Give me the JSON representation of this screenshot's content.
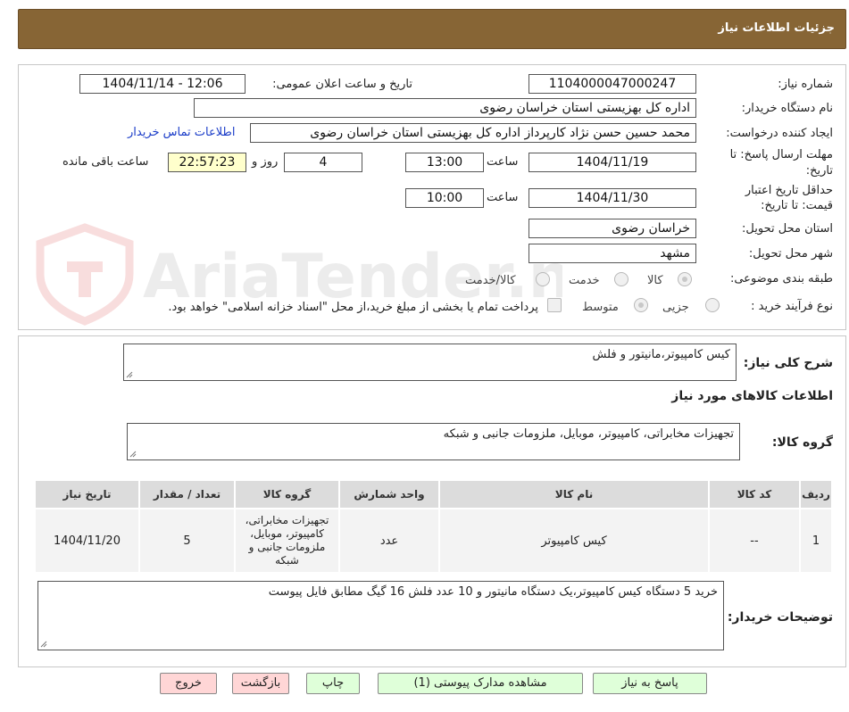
{
  "header": {
    "title": "جزئیات اطلاعات نیاز"
  },
  "fields": {
    "need_number_label": "شماره نیاز:",
    "need_number": "1104000047000247",
    "announce_label": "تاریخ و ساعت اعلان عمومی:",
    "announce_value": "1404/11/14 - 12:06",
    "buyer_org_label": "نام دستگاه خریدار:",
    "buyer_org": "اداره کل بهزیستی استان خراسان رضوی",
    "creator_label": "ایجاد کننده درخواست:",
    "creator": "محمد حسین حسن نژاد کارپرداز اداره کل بهزیستی استان خراسان رضوی",
    "contact_link": "اطلاعات تماس خریدار",
    "deadline_label_1": "مهلت ارسال پاسخ: تا",
    "deadline_label_2": "تاریخ:",
    "deadline_date": "1404/11/19",
    "hour_label": "ساعت",
    "deadline_time": "13:00",
    "days_value": "4",
    "days_label": "روز و",
    "remaining_time": "22:57:23",
    "remaining_label": "ساعت باقی مانده",
    "validity_label_1": "حداقل تاریخ اعتبار",
    "validity_label_2": "قیمت: تا تاریخ:",
    "validity_date": "1404/11/30",
    "validity_hour_label": "ساعت",
    "validity_time": "10:00",
    "province_label": "استان محل تحویل:",
    "province": "خراسان رضوی",
    "city_label": "شهر محل تحویل:",
    "city": "مشهد",
    "category_label": "طبقه بندی موضوعی:",
    "category_options": [
      "کالا",
      "خدمت",
      "کالا/خدمت"
    ],
    "process_label": "نوع فرآیند خرید :",
    "process_options": [
      "جزیی",
      "متوسط"
    ],
    "process_note": "پرداخت تمام یا بخشی از مبلغ خرید،از محل \"اسناد خزانه اسلامی\" خواهد بود."
  },
  "summary": {
    "label": "شرح کلی نیاز:",
    "text": "کیس کامپیوتر،مانیتور و فلش",
    "goods_info_title": "اطلاعات کالاهای مورد نیاز",
    "goods_group_label": "گروه کالا:",
    "goods_group": "تجهیزات مخابراتی، کامپیوتر، موبایل، ملزومات جانبی و شبکه"
  },
  "table": {
    "headers": [
      "ردیف",
      "کد کالا",
      "نام کالا",
      "واحد شمارش",
      "گروه کالا",
      "تعداد / مقدار",
      "تاریخ نیاز"
    ],
    "rows": [
      [
        "1",
        "--",
        "کیس کامپیوتر",
        "عدد",
        "تجهیزات مخابراتی، کامپیوتر، موبایل، ملزومات جانبی و شبکه",
        "5",
        "1404/11/20"
      ]
    ]
  },
  "buyer_notes": {
    "label": "توضیحات خریدار:",
    "text": "خرید 5 دستگاه کیس کامپیوتر،یک دستگاه مانیتور و 10 عدد فلش 16 گیگ مطابق فایل پیوست"
  },
  "buttons": {
    "reply": "پاسخ به نیاز",
    "attachments": "مشاهده مدارک پیوستی (1)",
    "print": "چاپ",
    "back": "بازگشت",
    "exit": "خروج"
  },
  "watermark": {
    "text": "AriaTender.neT"
  },
  "colors": {
    "header_bg": "#876535",
    "link": "#1a3cc8",
    "remaining_bg": "#ffffcc",
    "green_btn": "#dfffd9",
    "pink_btn": "#ffd6d6"
  }
}
